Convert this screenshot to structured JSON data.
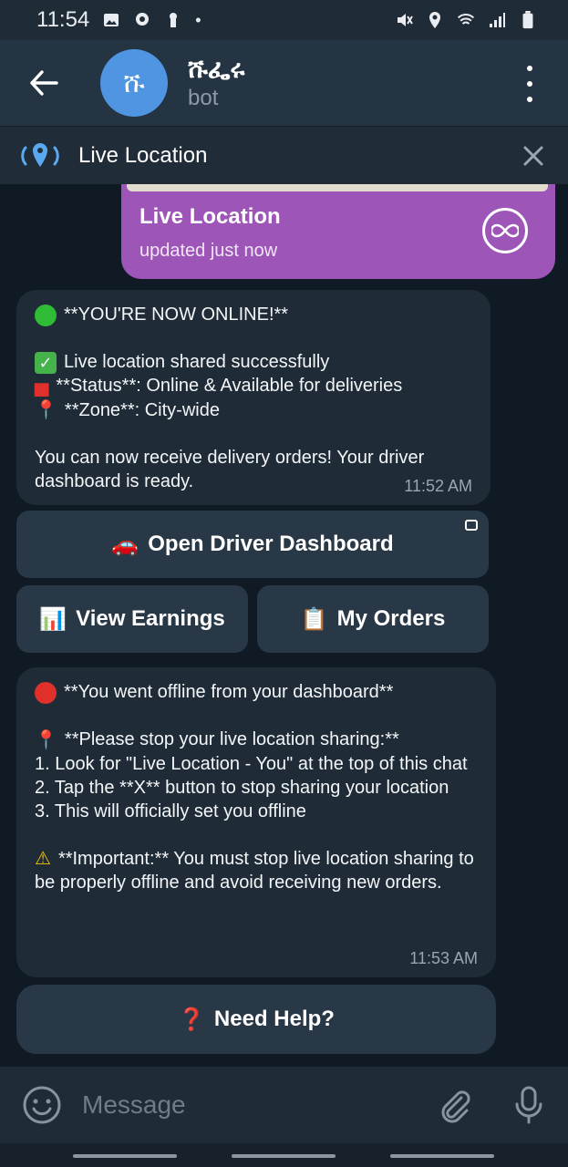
{
  "status_bar": {
    "time": "11:54"
  },
  "header": {
    "avatar_letter": "ሹ",
    "title": "ሹፌሩ",
    "subtitle": "bot"
  },
  "live_bar": {
    "title": "Live Location"
  },
  "live_card": {
    "title": "Live Location",
    "subtitle": "updated just now"
  },
  "message1": {
    "line1": "**YOU'RE NOW ONLINE!**",
    "line2": "Live location shared successfully",
    "line3": "**Status**: Online & Available for deliveries",
    "line4": "**Zone**: City-wide",
    "line5": "You can now receive delivery orders! Your driver dashboard is ready.",
    "time": "11:52 AM"
  },
  "buttons": {
    "dashboard": "Open Driver Dashboard",
    "earnings": "View Earnings",
    "orders": "My Orders",
    "help": "Need Help?"
  },
  "message2": {
    "line1": "**You went offline from your dashboard**",
    "line2": "**Please stop your live location sharing:**",
    "line3": "1. Look for \"Live Location - You\" at the top of this chat",
    "line4": "2. Tap the **X** button to stop sharing your location",
    "line5": "3. This will officially set you offline",
    "line6": "**Important:** You must stop live location sharing to be properly offline and avoid receiving new orders.",
    "time": "11:53 AM"
  },
  "input": {
    "placeholder": "Message"
  },
  "colors": {
    "header": "#253443",
    "bubble": "#1f2b36",
    "live_card": "#9d56b8",
    "avatar": "#4f95e2"
  }
}
